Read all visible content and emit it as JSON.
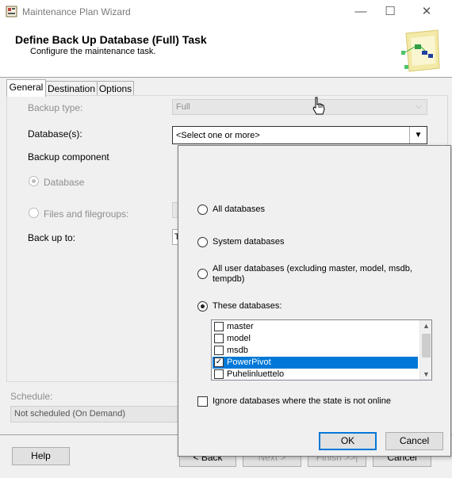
{
  "window": {
    "title": "Maintenance Plan Wizard",
    "minimize": "—",
    "maximize": "☐",
    "close": "✕"
  },
  "header": {
    "title": "Define Back Up Database (Full) Task",
    "subtitle": "Configure the maintenance task."
  },
  "tabs": [
    "General",
    "Destination",
    "Options"
  ],
  "form": {
    "backup_type_label": "Backup type:",
    "backup_type_value": "Full",
    "databases_label": "Database(s):",
    "databases_value": "<Select one or more>",
    "backup_component_label": "Backup component",
    "option_database": "Database",
    "option_files": "Files and filegroups:",
    "back_up_to_label": "Back up to:",
    "back_up_to_value": "T"
  },
  "schedule": {
    "label": "Schedule:",
    "value": "Not scheduled (On Demand)"
  },
  "footer": {
    "help": "Help",
    "back": "< Back",
    "next": "Next >",
    "finish": "Finish >>|",
    "cancel": "Cancel"
  },
  "popup": {
    "all_databases": "All databases",
    "system_databases": "System databases",
    "all_user_databases_line1": "All user databases  (excluding master, model, msdb,",
    "all_user_databases_line2": "tempdb)",
    "these_databases": "These databases:",
    "databases": [
      {
        "name": "master",
        "checked": false,
        "selected": false
      },
      {
        "name": "model",
        "checked": false,
        "selected": false
      },
      {
        "name": "msdb",
        "checked": false,
        "selected": false
      },
      {
        "name": "PowerPivot",
        "checked": true,
        "selected": true
      },
      {
        "name": "Puhelinluettelo",
        "checked": false,
        "selected": false
      }
    ],
    "ignore_offline": "Ignore databases where the state is not online",
    "ok": "OK",
    "cancel": "Cancel"
  }
}
